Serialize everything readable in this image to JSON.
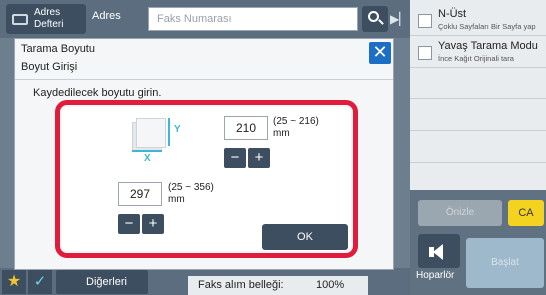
{
  "header": {
    "address_book_label_line1": "Adres",
    "address_book_label_line2": "Defteri",
    "address_tab": "Adres",
    "fax_placeholder": "Faks Numarası"
  },
  "right_panel": {
    "options": [
      {
        "title": "N-Üst",
        "subtitle": "Çoklu Sayfaları Bir Sayfa yap"
      },
      {
        "title": "Yavaş Tarama Modu",
        "subtitle": "İnce Kağıt Orijinali tara"
      }
    ],
    "start_label": "Önizle",
    "ca_label": "CA",
    "speaker_label": "Hoparlör",
    "big_button_label": "Başlat"
  },
  "footer": {
    "others_label": "Diğerleri",
    "memory_label": "Faks alım belleği:",
    "memory_value": "100%"
  },
  "dialog": {
    "title": "Tarama Boyutu",
    "subtitle": "Boyut Girişi",
    "instruction": "Kaydedilecek boyutu girin.",
    "x_axis": "X",
    "y_axis": "Y",
    "y_value": "210",
    "y_range": "(25 ~ 216)",
    "y_unit": "mm",
    "x_value": "297",
    "x_range": "(25 ~ 356)",
    "x_unit": "mm",
    "minus": "−",
    "plus": "+",
    "ok_label": "OK",
    "close_symbol": "✕"
  },
  "colors": {
    "accent_blue": "#1d6fc6",
    "highlight_red": "#e11b3c",
    "ca_yellow": "#f4d320",
    "dimension_cyan": "#3fb6d6"
  }
}
